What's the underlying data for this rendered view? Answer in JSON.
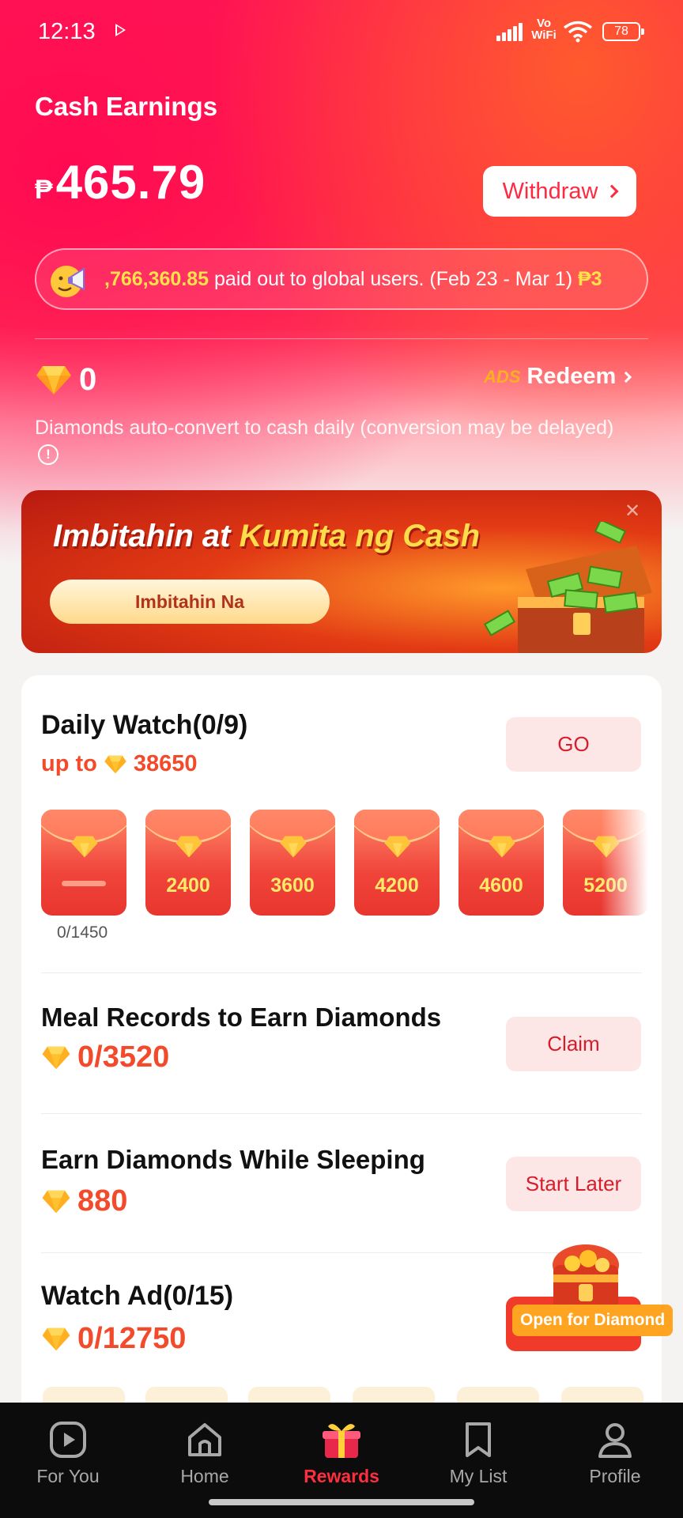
{
  "status_bar": {
    "time": "12:13",
    "network": "Vo WiFi",
    "battery": "78"
  },
  "wallet": {
    "title": "Cash Earnings",
    "currency_symbol": "₱",
    "amount": "465.79",
    "withdraw_label": "Withdraw"
  },
  "ticker": {
    "amount_text": ",766,360.85",
    "message": " paid out to global users. (Feb 23 - Mar 1) ",
    "trailing_text": "₱3"
  },
  "diamonds": {
    "count": "0",
    "redeem_label": "Redeem",
    "ads_label": "ADS",
    "note": "Diamonds auto-convert to cash daily (conversion may be delayed)"
  },
  "banner": {
    "title_part1": "Imbitahin at ",
    "title_part2": "Kumita ng Cash",
    "button_label": "Imbitahin Na"
  },
  "tasks": {
    "daily_watch": {
      "title": "Daily Watch(0/9)",
      "subtitle_prefix": "up to",
      "subtitle_value": "38650",
      "button": "GO",
      "envelopes": [
        {
          "value": "",
          "progress": "0/1450"
        },
        {
          "value": "2400"
        },
        {
          "value": "3600"
        },
        {
          "value": "4200"
        },
        {
          "value": "4600"
        },
        {
          "value": "5200"
        }
      ]
    },
    "meal_records": {
      "title": "Meal Records to Earn Diamonds",
      "value": "0/3520",
      "button": "Claim"
    },
    "sleeping": {
      "title": "Earn Diamonds While Sleeping",
      "value": "880",
      "button": "Start Later"
    },
    "watch_ad": {
      "title": "Watch Ad(0/15)",
      "value": "0/12750",
      "floating_label": "Open for Diamond"
    }
  },
  "nav": {
    "items": [
      {
        "label": "For You",
        "icon": "play-square-icon"
      },
      {
        "label": "Home",
        "icon": "home-icon"
      },
      {
        "label": "Rewards",
        "icon": "gift-icon"
      },
      {
        "label": "My List",
        "icon": "bookmark-icon"
      },
      {
        "label": "Profile",
        "icon": "person-icon"
      }
    ],
    "active_index": 2
  },
  "colors": {
    "brand_red": "#ff2a4a",
    "accent_orange": "#f24a2a",
    "nav_active": "#ff2e3e",
    "gold": "#ffe24a"
  }
}
